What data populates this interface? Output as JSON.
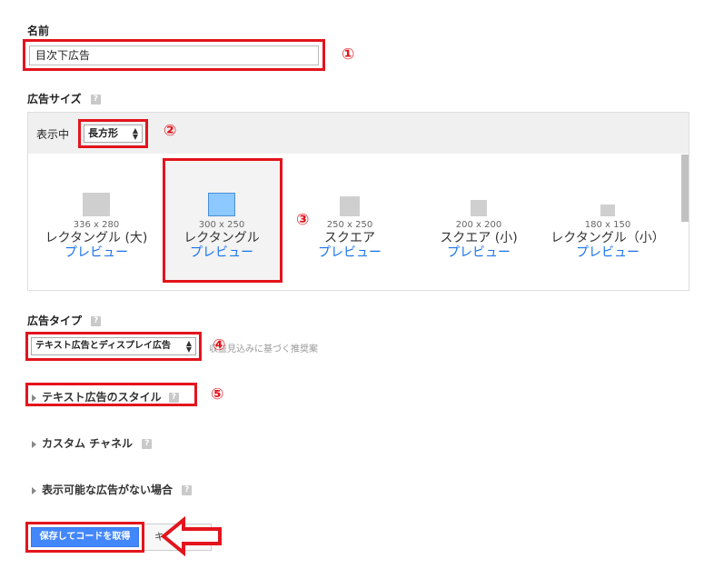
{
  "name_section": {
    "label": "名前",
    "value": "目次下広告",
    "marker": "①"
  },
  "size_section": {
    "label": "広告サイズ",
    "display_label": "表示中",
    "display_value": "長方形",
    "marker_select": "②",
    "marker_selected": "③",
    "sizes": [
      {
        "dim": "336 x 280",
        "name": "レクタングル (大)",
        "preview": "プレビュー"
      },
      {
        "dim": "300 x 250",
        "name": "レクタングル",
        "preview": "プレビュー"
      },
      {
        "dim": "250 x 250",
        "name": "スクエア",
        "preview": "プレビュー"
      },
      {
        "dim": "200 x 200",
        "name": "スクエア (小)",
        "preview": "プレビュー"
      },
      {
        "dim": "180 x 150",
        "name": "レクタングル（小）",
        "preview": "プレビュー"
      }
    ]
  },
  "type_section": {
    "label": "広告タイプ",
    "select_value": "テキスト広告とディスプレイ広告",
    "note": "収益見込みに基づく推奨案",
    "marker": "④"
  },
  "text_style": {
    "label": "テキスト広告のスタイル",
    "marker": "⑤"
  },
  "custom_channel": {
    "label": "カスタム チャネル"
  },
  "no_ads": {
    "label": "表示可能な広告がない場合"
  },
  "buttons": {
    "save": "保存してコードを取得",
    "cancel": "キ"
  },
  "help_glyph": "?",
  "colors": {
    "accent_red": "#e3141d",
    "primary_blue": "#4387fd",
    "link_blue": "#1a73e8",
    "selected_thumb": "#8dc8ff"
  }
}
